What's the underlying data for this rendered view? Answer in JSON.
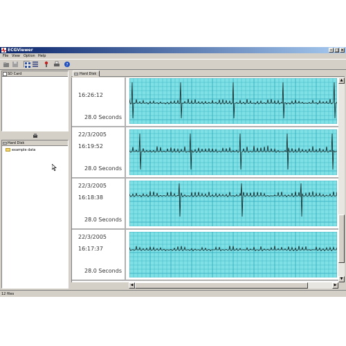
{
  "window": {
    "title": "ECGViewer",
    "controls": {
      "minimize": "-",
      "maximize": "□",
      "close": "×"
    }
  },
  "menu": [
    "File",
    "View",
    "Option",
    "Help"
  ],
  "toolbar": {
    "buttons": [
      "open-icon",
      "save-icon",
      "thumbnail-view-icon",
      "list-view-icon",
      "filter-icon",
      "print-icon",
      "help-icon"
    ]
  },
  "left_pane": {
    "sd_card_label": "SD Card",
    "hard_disk_label": "Hard Disk",
    "tree_items": [
      "example data"
    ]
  },
  "right_pane": {
    "tab_label": "Hard Disk",
    "records": [
      {
        "date": "",
        "time": "16:26:12",
        "duration": "28.0 Seconds"
      },
      {
        "date": "22/3/2005",
        "time": "16:19:52",
        "duration": "28.0 Seconds"
      },
      {
        "date": "22/3/2005",
        "time": "16:18:38",
        "duration": "28.0 Seconds"
      },
      {
        "date": "22/3/2005",
        "time": "16:17:37",
        "duration": "28.0 Seconds"
      }
    ]
  },
  "status": {
    "text": "12 files"
  },
  "colors": {
    "ecg_background": "#7fe0e6",
    "ecg_grid": "#2fa9b8",
    "ecg_trace": "#102020",
    "title_gradient_start": "#0a246a",
    "title_gradient_end": "#a6caf0"
  }
}
